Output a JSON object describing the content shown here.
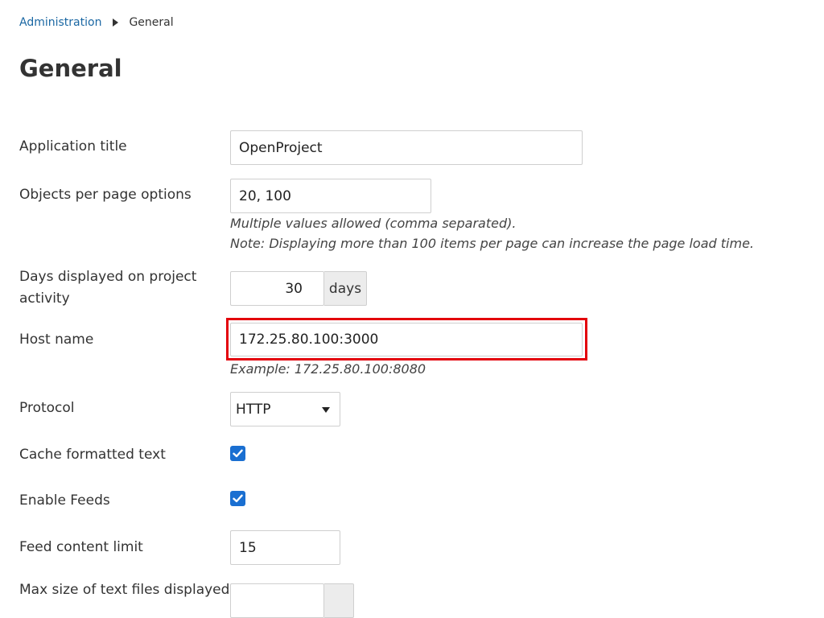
{
  "breadcrumb": {
    "parent": "Administration",
    "current": "General"
  },
  "page_title": "General",
  "fields": {
    "app_title": {
      "label": "Application title",
      "value": "OpenProject"
    },
    "objects_per_page": {
      "label": "Objects per page options",
      "value": "20, 100",
      "hint1": "Multiple values allowed (comma separated).",
      "hint2": "Note: Displaying more than 100 items per page can increase the page load time."
    },
    "activity_days": {
      "label": "Days displayed on project activity",
      "value": "30",
      "unit": "days"
    },
    "host_name": {
      "label": "Host name",
      "value": "172.25.80.100:3000",
      "hint": "Example: 172.25.80.100:8080"
    },
    "protocol": {
      "label": "Protocol",
      "value": "HTTP"
    },
    "cache_text": {
      "label": "Cache formatted text",
      "checked": true
    },
    "enable_feeds": {
      "label": "Enable Feeds",
      "checked": true
    },
    "feed_limit": {
      "label": "Feed content limit",
      "value": "15"
    },
    "max_text_size": {
      "label": "Max size of text files displayed"
    }
  },
  "colors": {
    "link": "#1a67a3",
    "checkbox": "#1a6fd1",
    "highlight": "#e3000b"
  }
}
